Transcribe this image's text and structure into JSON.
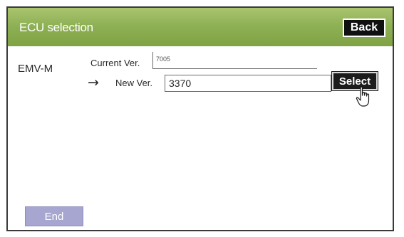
{
  "header": {
    "title": "ECU selection",
    "back_label": "Back"
  },
  "ecu": {
    "name": "EMV-M",
    "current_version_label": "Current Ver.",
    "current_version_value": "7005",
    "new_version_label": "New Ver.",
    "new_version_value": "3370",
    "select_label": "Select"
  },
  "footer": {
    "end_label": "End"
  },
  "icons": {
    "arrow": "right-arrow-icon",
    "pointer": "hand-pointer-icon"
  },
  "colors": {
    "header_green": "#8fb155",
    "button_dark": "#101010",
    "end_button_lavender": "#a6a6d0"
  }
}
